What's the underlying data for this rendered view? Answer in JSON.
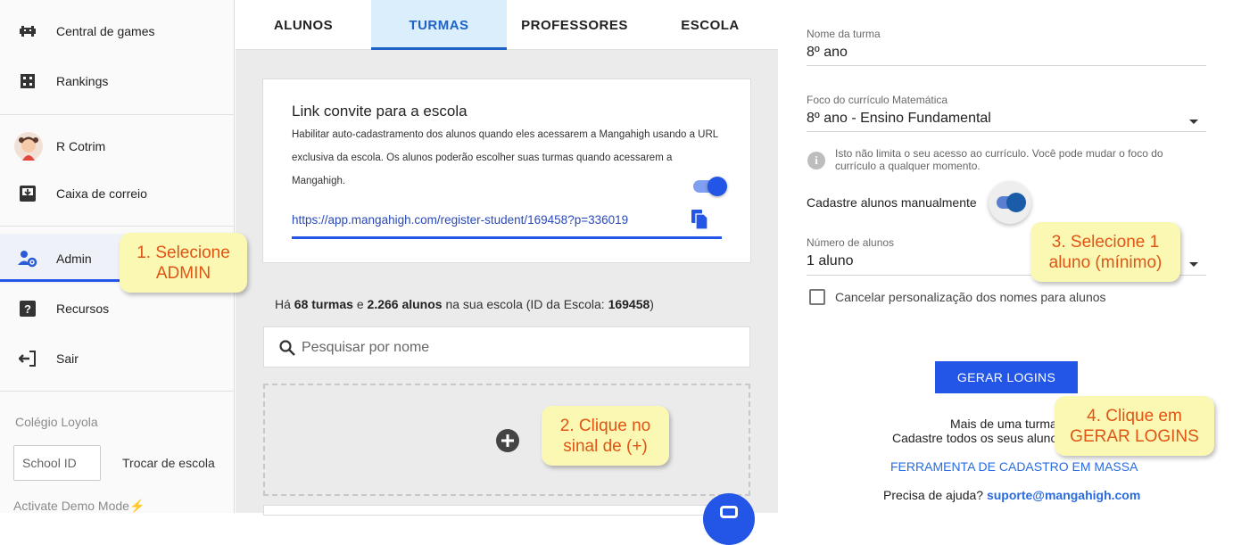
{
  "sidebar": {
    "items": [
      {
        "label": "Central de games",
        "icon": "gamepad-icon"
      },
      {
        "label": "Rankings",
        "icon": "grid-icon"
      },
      {
        "label": "R Cotrim",
        "icon": "avatar"
      },
      {
        "label": "Caixa de correio",
        "icon": "inbox-icon"
      },
      {
        "label": "Admin",
        "icon": "admin-users-icon"
      },
      {
        "label": "Recursos",
        "icon": "help-icon"
      },
      {
        "label": "Sair",
        "icon": "logout-icon"
      }
    ],
    "school_name": "Colégio Loyola",
    "school_id_placeholder": "School ID",
    "change_school_label": "Trocar de escola",
    "demo_mode_label": "Activate Demo Mode",
    "demo_mode_icon": "⚡"
  },
  "tabs": [
    {
      "label": "ALUNOS",
      "active": false
    },
    {
      "label": "TURMAS",
      "active": true
    },
    {
      "label": "PROFESSORES",
      "active": false
    },
    {
      "label": "ESCOLA",
      "active": false
    }
  ],
  "invite": {
    "title": "Link convite para a escola",
    "description": "Habilitar auto-cadastramento dos alunos quando eles acessarem a Mangahigh usando a URL exclusiva da escola. Os alunos poderão escolher suas turmas quando acessarem a Mangahigh.",
    "link": "https://app.mangahigh.com/register-student/169458?p=336019",
    "enabled": true
  },
  "counts": {
    "prefix": "Há",
    "classes": "68 turmas",
    "conj": "e",
    "students": "2.266 alunos",
    "middle": "na sua escola (ID da Escola:",
    "school_id": "169458",
    "suffix": ")"
  },
  "search": {
    "placeholder": "Pesquisar por nome"
  },
  "form": {
    "class_name_label": "Nome da turma",
    "class_name_value": "8º ano",
    "curriculum_label": "Foco do currículo Matemática",
    "curriculum_value": "8º ano - Ensino Fundamental",
    "curriculum_info": "Isto não limita o seu acesso ao currículo. Você pode mudar o foco do currículo a qualquer momento.",
    "manual_label": "Cadastre alunos manualmente",
    "manual_enabled": true,
    "num_students_label": "Número de alunos",
    "num_students_value": "1 aluno",
    "cancel_personalization_label": "Cancelar personalização dos nomes para alunos",
    "generate_button": "GERAR LOGINS",
    "more_line1": "Mais de uma turma",
    "more_line2": "Cadastre todos os seus aluno",
    "mass_tool_link": "FERRAMENTA DE CADASTRO EM MASSA",
    "help_prefix": "Precisa de ajuda?",
    "help_email": "suporte@mangahigh.com"
  },
  "callouts": {
    "c1": [
      "1. Selecione",
      "ADMIN"
    ],
    "c2": [
      "2. Clique no",
      "sinal de (+)"
    ],
    "c3": [
      "3. Selecione 1",
      "aluno (mínimo)"
    ],
    "c4": [
      "4. Clique em",
      "GERAR LOGINS"
    ]
  },
  "colors": {
    "accent": "#2356e6",
    "active_tab_bg": "#dbeefb",
    "callout_bg": "#fbf8b4",
    "callout_text": "#e05414"
  }
}
